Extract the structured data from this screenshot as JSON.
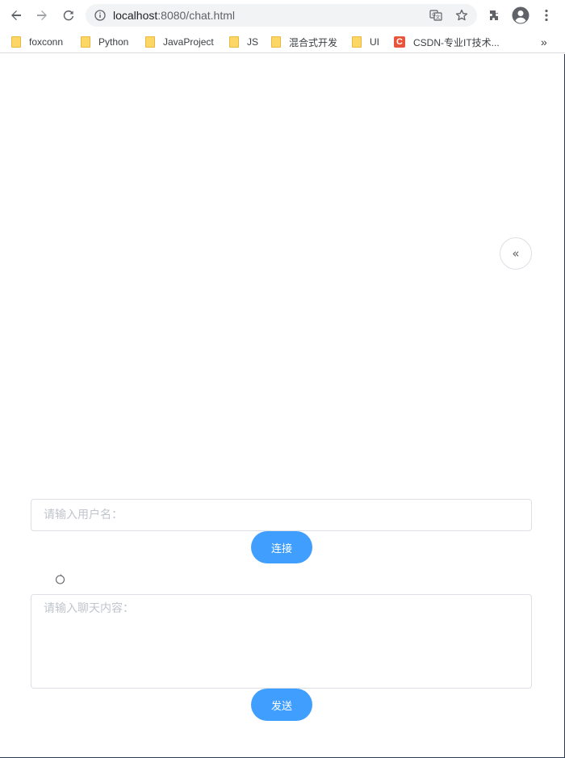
{
  "browser": {
    "url_host": "localhost",
    "url_path": ":8080/chat.html",
    "icons": [
      "back-icon",
      "forward-icon",
      "reload-icon",
      "info-icon",
      "translate-icon",
      "star-icon",
      "extensions-icon",
      "profile-icon",
      "menu-icon"
    ]
  },
  "bookmarks": {
    "items": [
      {
        "label": "foxconn",
        "icon": "folder-icon"
      },
      {
        "label": "Python",
        "icon": "folder-icon"
      },
      {
        "label": "JavaProject",
        "icon": "folder-icon"
      },
      {
        "label": "JS",
        "icon": "folder-icon"
      },
      {
        "label": "混合式开发",
        "icon": "folder-icon"
      },
      {
        "label": "UI",
        "icon": "folder-icon"
      },
      {
        "label": "CSDN-专业IT技术...",
        "icon": "csdn-icon"
      }
    ],
    "overflow_label": "»",
    "csdn_glyph": "C"
  },
  "chat": {
    "username_placeholder": "请输入用户名：",
    "connect_label": "连接",
    "message_placeholder": "请输入聊天内容：",
    "send_label": "发送",
    "toggle_glyph": "«"
  },
  "colors": {
    "primary": "#409eff",
    "border": "#dcdfe6",
    "placeholder": "#c0c4cc"
  }
}
